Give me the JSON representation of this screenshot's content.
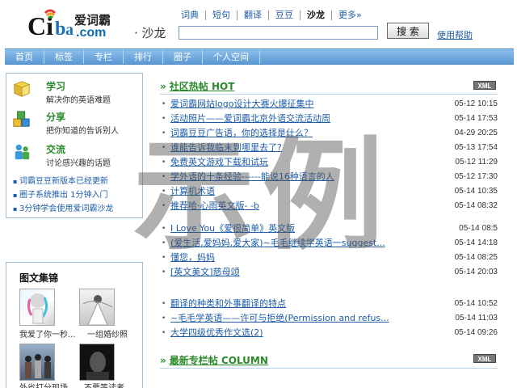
{
  "logo": {
    "cn_name": "爱词霸",
    "domain": ".com",
    "subtitle": "· 沙龙"
  },
  "topnav": {
    "items": [
      "词典",
      "短句",
      "翻译",
      "豆豆",
      "沙龙",
      "更多»"
    ],
    "active": "沙龙"
  },
  "search": {
    "value": "",
    "placeholder": "",
    "button_label": "搜 索",
    "help_label": "使用帮助"
  },
  "mainnav": {
    "items": [
      "首页",
      "标签",
      "专栏",
      "排行",
      "圈子",
      "个人空间"
    ]
  },
  "features": [
    {
      "title": "学习",
      "desc": "解决你的英语难题",
      "icon": "book-icon",
      "color": "#e8c23a"
    },
    {
      "title": "分享",
      "desc": "把你知道的告诉别人",
      "icon": "cubes-icon",
      "color": "#3a8fd8"
    },
    {
      "title": "交流",
      "desc": "讨论感兴趣的话题",
      "icon": "people-icon",
      "color": "#4aa84a"
    }
  ],
  "news": [
    "词霸豆豆新版本已经更新",
    "圈子系统推出 1分钟入门",
    "3分钟学会使用爱词霸沙龙"
  ],
  "gallery": {
    "title": "图文集锦",
    "captions": [
      "我爱了你一秒...",
      "一组婚纱照",
      "外省打分现场",
      "不要等读者"
    ]
  },
  "hot": {
    "title": "社区热帖  HOT",
    "xml_label": "XML",
    "group1": [
      {
        "title": "爱词霸网站logo设计大赛火爆征集中",
        "date": "05-12 10:15"
      },
      {
        "title": "活动照片——爱词霸北京外语交流活动周",
        "date": "05-14 17:53"
      },
      {
        "title": "词霸豆豆广告语，你的选择是什么？",
        "date": "04-29 20:25"
      },
      {
        "title": "谁能告诉我临末到哪里去了?",
        "date": "05-13 17:54"
      },
      {
        "title": "免费英文游戏下载和试玩",
        "date": "05-12 11:29"
      },
      {
        "title": "学外语的十条经验------能说16种语言的人",
        "date": "05-12 17:30"
      },
      {
        "title": "计算机术语",
        "date": "05-14 10:35"
      },
      {
        "title": "推荐哈·心雨英文版- -b",
        "date": "05-14 08:32"
      }
    ],
    "group2": [
      {
        "title": "I Love You《爱很简单》英文版",
        "date": "05-14 08:5"
      },
      {
        "title": "(爱生活,爱妈妈,爱大家)~毛毛继续学英语一suggest...",
        "date": "05-14 14:18"
      },
      {
        "title": "懂您，妈妈",
        "date": "05-14 08:25"
      },
      {
        "title": "[英文美文]慈母颂",
        "date": "05-14 20:03"
      }
    ],
    "group3": [
      {
        "title": "翻译的种类和外事翻译的特点",
        "date": "05-14 10:52"
      },
      {
        "title": "~毛毛学英语——许可与拒绝(Permission and refus...",
        "date": "05-14 11:03"
      },
      {
        "title": "大学四级优秀作文选(2)",
        "date": "05-14 09:26"
      }
    ]
  },
  "column": {
    "title": "最新专栏帖  COLUMN",
    "xml_label": "XML"
  },
  "watermark": "示例"
}
